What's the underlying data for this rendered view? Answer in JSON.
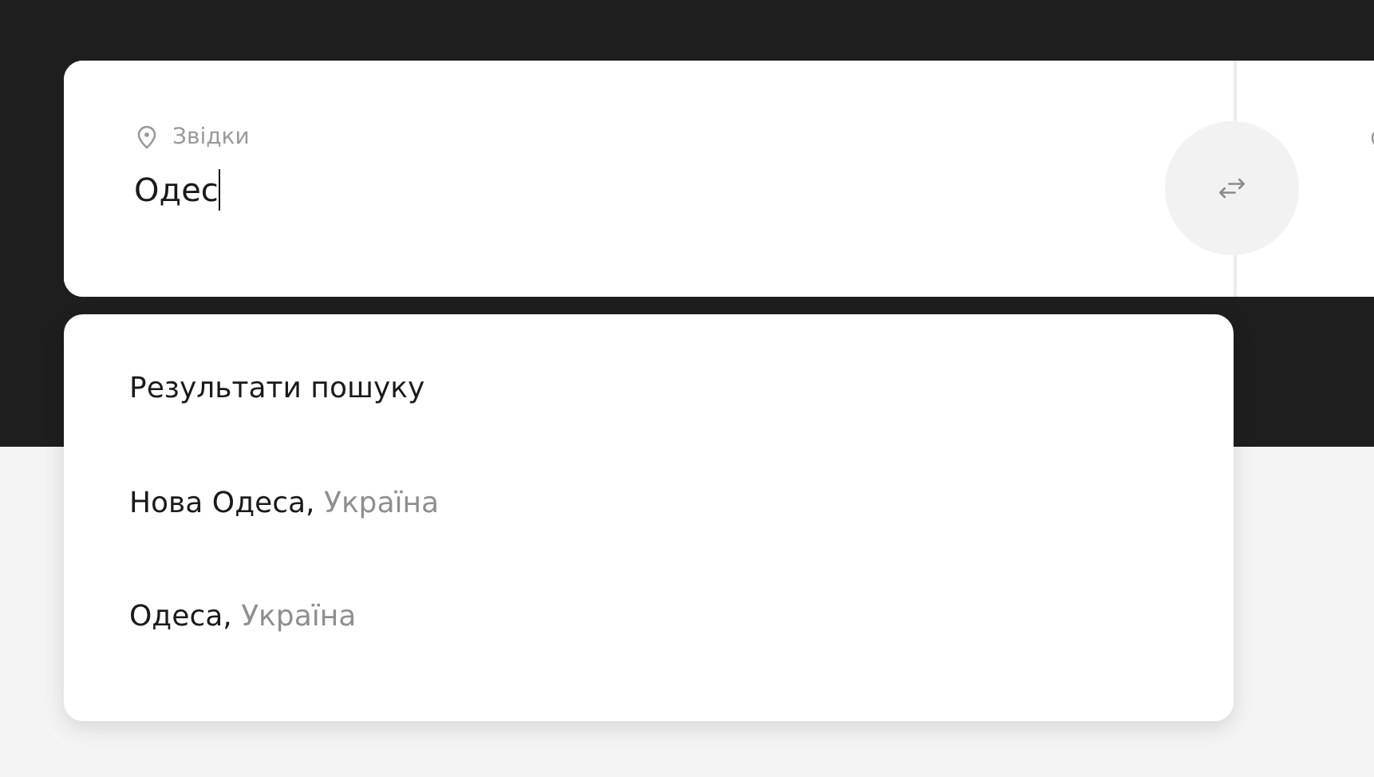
{
  "from_field": {
    "label": "Звідки",
    "value": "Одес",
    "focused": true
  },
  "search_results": {
    "title": "Результати пошуку",
    "items": [
      {
        "city": "Нова Одеса,",
        "country": "Україна"
      },
      {
        "city": "Одеса,",
        "country": "Україна"
      }
    ]
  }
}
